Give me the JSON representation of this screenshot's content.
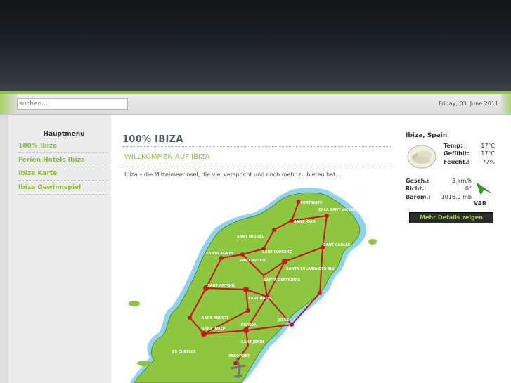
{
  "search": {
    "placeholder": "suchen..."
  },
  "date": "Friday, 03. June 2011",
  "sidebar": {
    "title": "Hauptmenü",
    "items": [
      {
        "label": "100% Ibiza"
      },
      {
        "label": "Ferien Hotels Ibiza"
      },
      {
        "label": "Ibiza Karte"
      },
      {
        "label": "Ibiza Gewinnspiel"
      }
    ]
  },
  "main": {
    "title": "100% IBIZA",
    "subtitle": "WILLKOMMEN AUF IBIZA",
    "intro": "Ibiza – die Mittelmeerinsel, die viel verspricht und noch mehr zu bieten hat...",
    "map": {
      "labels": [
        "PORTINATX",
        "SANT JOAN",
        "SANT MIQUEL",
        "SANT LLORENÇ",
        "SANTA AGNES",
        "SANT MATEU",
        "SANTA GERTRUDIS",
        "SANTA EULARIA DES RIU",
        "SANT CARLES",
        "SANT ANTONI",
        "SANT RAFEL",
        "SANT AGUSTI",
        "SANT JOSEP",
        "EIVISSA",
        "JESUS",
        "ES CUBELLS",
        "AEROPORT",
        "SANT JORDI",
        "CALA SANT VICENT"
      ]
    }
  },
  "weather": {
    "city": "Ibiza, Spain",
    "icon": "cloudy-weather-icon",
    "temp_label": "Temp:",
    "temp_value": "17°C",
    "feels_label": "Gefühlt:",
    "feels_value": "17°C",
    "humidity_label": "Feucht.:",
    "humidity_value": "77%",
    "speed_label": "Gesch.:",
    "speed_value": "3 km/h",
    "dir_label": "Richt.:",
    "dir_value": "0°",
    "baro_label": "Barom.:",
    "baro_value": "1016.9 mb",
    "wind_code": "VAR",
    "details_button": "Mehr Details zeigen"
  },
  "colors": {
    "accent": "#8cbf2f",
    "header": "#1b2024"
  }
}
